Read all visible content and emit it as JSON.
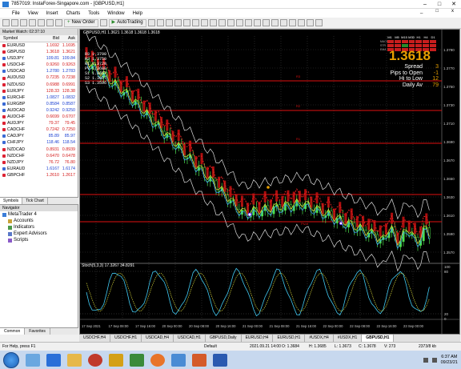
{
  "window": {
    "title": "7857019: InstaForex-Singapore.com - [GBPUSD,H1]",
    "buttons": [
      "–",
      "□",
      "✕"
    ]
  },
  "menu": {
    "items": [
      "File",
      "View",
      "Insert",
      "Charts",
      "Tools",
      "Window",
      "Help"
    ],
    "mdi": [
      "_",
      "□",
      "x"
    ]
  },
  "toolbar": {
    "new_order": "New Order",
    "autotrading": "AutoTrading"
  },
  "market_watch": {
    "header": "Market Watch: 02:37:10",
    "cols": {
      "symbol": "Symbol",
      "bid": "Bid",
      "ask": "Ask"
    },
    "rows": [
      {
        "symbol": "EURUSD",
        "bid": "1.1692",
        "ask": "1.1695",
        "dir": "dn"
      },
      {
        "symbol": "GBPUSD",
        "bid": "1.3618",
        "ask": "1.3621",
        "dir": "dn"
      },
      {
        "symbol": "USDJPY",
        "bid": "109.81",
        "ask": "109.84",
        "dir": "up"
      },
      {
        "symbol": "USDCHF",
        "bid": "0.9260",
        "ask": "0.9263",
        "dir": "dn"
      },
      {
        "symbol": "USDCAD",
        "bid": "1.2780",
        "ask": "1.2783",
        "dir": "up"
      },
      {
        "symbol": "AUDUSD",
        "bid": "0.7235",
        "ask": "0.7238",
        "dir": "dn"
      },
      {
        "symbol": "NZDUSD",
        "bid": "0.6988",
        "ask": "0.6991",
        "dir": "dn"
      },
      {
        "symbol": "EURJPY",
        "bid": "128.33",
        "ask": "128.38",
        "dir": "dn"
      },
      {
        "symbol": "EURCHF",
        "bid": "1.0827",
        "ask": "1.0832",
        "dir": "up"
      },
      {
        "symbol": "EURGBP",
        "bid": "0.8584",
        "ask": "0.8587",
        "dir": "up"
      },
      {
        "symbol": "AUDCAD",
        "bid": "0.9242",
        "ask": "0.9250",
        "dir": "up"
      },
      {
        "symbol": "AUDCHF",
        "bid": "0.6699",
        "ask": "0.6707",
        "dir": "dn"
      },
      {
        "symbol": "AUDJPY",
        "bid": "79.37",
        "ask": "79.45",
        "dir": "dn"
      },
      {
        "symbol": "CADCHF",
        "bid": "0.7242",
        "ask": "0.7250",
        "dir": "dn"
      },
      {
        "symbol": "CADJPY",
        "bid": "85.89",
        "ask": "85.97",
        "dir": "up"
      },
      {
        "symbol": "CHFJPY",
        "bid": "118.46",
        "ask": "118.54",
        "dir": "up"
      },
      {
        "symbol": "NZDCAD",
        "bid": "0.8931",
        "ask": "0.8939",
        "dir": "dn"
      },
      {
        "symbol": "NZDCHF",
        "bid": "0.6470",
        "ask": "0.6478",
        "dir": "dn"
      },
      {
        "symbol": "NZDJPY",
        "bid": "76.72",
        "ask": "76.80",
        "dir": "dn"
      },
      {
        "symbol": "EURAUD",
        "bid": "1.6167",
        "ask": "1.6174",
        "dir": "up"
      },
      {
        "symbol": "GBPCHF",
        "bid": "1.2610",
        "ask": "1.2617",
        "dir": "dn"
      }
    ],
    "tabs": [
      "Symbols",
      "Tick Chart"
    ]
  },
  "navigator": {
    "header": "Navigator",
    "root": "MetaTrader 4",
    "items": [
      "Accounts",
      "Indicators",
      "Expert Advisors",
      "Scripts"
    ],
    "tabs": [
      "Common",
      "Favorites"
    ]
  },
  "chart": {
    "symbol_label": "GBPUSD,H1  1.3621 1.3618 1.3618 1.3618",
    "price_big": "1.3618",
    "info_labels": [
      "Spread",
      "Pips to Open",
      "Hi to Low",
      "Daily Av"
    ],
    "info_values": [
      "3",
      "-1",
      "12",
      "79"
    ],
    "tf_labels": [
      "M1",
      "M5",
      "M15",
      "M30",
      "H1",
      "H4",
      "D1"
    ],
    "side_labels": [
      "MACD",
      "STR",
      "EMA"
    ],
    "price_axis": [
      "1.3790",
      "1.3770",
      "1.3750",
      "1.3730",
      "1.3710",
      "1.3690",
      "1.3670",
      "1.3650",
      "1.3630",
      "1.3610",
      "1.3590",
      "1.3570"
    ],
    "indicator_axis": [
      "100",
      "80",
      "20",
      "0"
    ],
    "time_axis": [
      "17 Sep 2021",
      "17 Sep 08:00",
      "17 Sep 16:00",
      "20 Sep 00:00",
      "20 Sep 08:00",
      "20 Sep 16:00",
      "21 Sep 00:00",
      "21 Sep 08:00",
      "21 Sep 16:00",
      "22 Sep 00:00",
      "22 Sep 08:00",
      "22 Sep 16:00",
      "23 Sep 00:00"
    ],
    "stoch_label": "Stoch(5,3,3) 17.3267 34.8291",
    "level_labels": [
      "R3",
      "R2",
      "R1",
      "Pivot"
    ],
    "pivots_text": [
      "R3 1.3790",
      "R2 1.3750",
      "R1 1.3720",
      "PV 1.3688",
      "S1 1.3657",
      "S2 1.3627",
      "S3 1.3596"
    ]
  },
  "chart_tabs": [
    "USDCHF,H4",
    "USDCHF,H1",
    "USDCAD,H4",
    "USDCAD,H1",
    "GBPUSD,Daily",
    "EURUSD,H4",
    "EURUSD,H1",
    "#USDX,H4",
    "#USDX,H1",
    "GBPUSD,H1"
  ],
  "status": {
    "help": "For Help, press F1",
    "profile": "Default",
    "datetime": "2021.09.21 14:00",
    "open": "O: 1.3684",
    "high": "H: 1.3685",
    "low": "L: 1.3673",
    "close": "C: 1.3678",
    "volume": "V: 273",
    "traffic": "2373/8 kb"
  },
  "clock": {
    "time": "6:37 AM",
    "date": "09/23/21"
  }
}
